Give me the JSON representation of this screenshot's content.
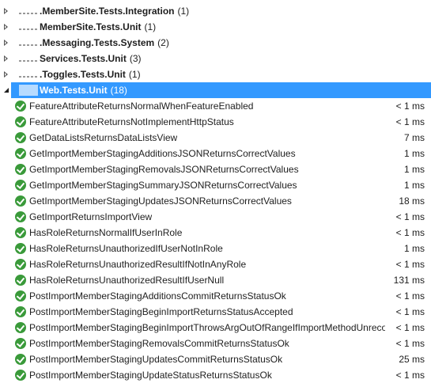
{
  "groups_collapsed": [
    {
      "name": ".MemberSite.Tests.Integration",
      "count": "(1)"
    },
    {
      "name": "MemberSite.Tests.Unit",
      "count": "(1)"
    },
    {
      "name": ".Messaging.Tests.System",
      "count": "(2)"
    },
    {
      "name": "Services.Tests.Unit",
      "count": "(3)"
    },
    {
      "name": ".Toggles.Tests.Unit",
      "count": "(1)"
    }
  ],
  "selected_group": {
    "name": "Web.Tests.Unit",
    "count": "(18)"
  },
  "tests": [
    {
      "name": "FeatureAttributeReturnsNormalWhenFeatureEnabled",
      "duration": "< 1 ms"
    },
    {
      "name": "FeatureAttributeReturnsNotImplementHttpStatus",
      "duration": "< 1 ms"
    },
    {
      "name": "GetDataListsReturnsDataListsView",
      "duration": "7 ms"
    },
    {
      "name": "GetImportMemberStagingAdditionsJSONReturnsCorrectValues",
      "duration": "1 ms"
    },
    {
      "name": "GetImportMemberStagingRemovalsJSONReturnsCorrectValues",
      "duration": "1 ms"
    },
    {
      "name": "GetImportMemberStagingSummaryJSONReturnsCorrectValues",
      "duration": "1 ms"
    },
    {
      "name": "GetImportMemberStagingUpdatesJSONReturnsCorrectValues",
      "duration": "18 ms"
    },
    {
      "name": "GetImportReturnsImportView",
      "duration": "< 1 ms"
    },
    {
      "name": "HasRoleReturnsNormalIfUserInRole",
      "duration": "< 1 ms"
    },
    {
      "name": "HasRoleReturnsUnauthorizedIfUserNotInRole",
      "duration": "1 ms"
    },
    {
      "name": "HasRoleReturnsUnauthorizedResultIfNotInAnyRole",
      "duration": "< 1 ms"
    },
    {
      "name": "HasRoleReturnsUnauthorizedResultIfUserNull",
      "duration": "131 ms"
    },
    {
      "name": "PostImportMemberStagingAdditionsCommitReturnsStatusOk",
      "duration": "< 1 ms"
    },
    {
      "name": "PostImportMemberStagingBeginImportReturnsStatusAccepted",
      "duration": "< 1 ms"
    },
    {
      "name": "PostImportMemberStagingBeginImportThrowsArgOutOfRangeIfImportMethodUnrecog...",
      "duration": "< 1 ms"
    },
    {
      "name": "PostImportMemberStagingRemovalsCommitReturnsStatusOk",
      "duration": "< 1 ms"
    },
    {
      "name": "PostImportMemberStagingUpdatesCommitReturnsStatusOk",
      "duration": "25 ms"
    },
    {
      "name": "PostImportMemberStagingUpdateStatusReturnsStatusOk",
      "duration": "< 1 ms"
    }
  ],
  "colors": {
    "selection": "#3399ff",
    "pass": "#3a9a3a"
  },
  "icons": {
    "group_collapsed": "chevron-right-icon",
    "group_expanded": "chevron-down-icon",
    "test_passed": "passed-check-icon"
  }
}
